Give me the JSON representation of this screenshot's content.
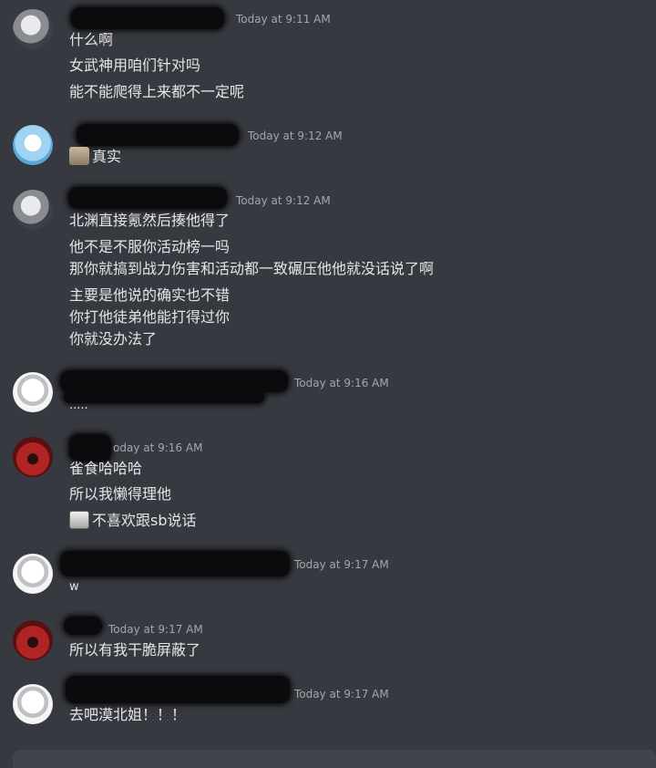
{
  "messages": [
    {
      "timestamp": "Today at 9:11 AM",
      "lines": [
        "什么啊",
        "女武神用咱们针对吗",
        "能不能爬得上来都不一定呢"
      ]
    },
    {
      "timestamp": "Today at 9:12 AM",
      "lines": [
        "真实"
      ]
    },
    {
      "timestamp": "Today at 9:12 AM",
      "lines": [
        "北渊直接氪然后揍他得了",
        "他不是不服你活动榜一吗",
        "那你就搞到战力伤害和活动都一致碾压他他就没话说了啊",
        "主要是他说的确实也不错",
        "你打他徒弟他能打得过你",
        "你就没办法了"
      ]
    },
    {
      "timestamp": "Today at 9:16 AM",
      "lines": [
        ".....",
        ""
      ]
    },
    {
      "timestamp": "oday at 9:16 AM",
      "lines": [
        "雀食哈哈哈",
        "所以我懒得理他",
        "不喜欢跟sb说话"
      ]
    },
    {
      "timestamp": "Today at 9:17 AM",
      "lines": [
        "w"
      ]
    },
    {
      "timestamp": "Today at 9:17 AM",
      "lines": [
        "所以有我干脆屏蔽了"
      ]
    },
    {
      "timestamp": "Today at 9:17 AM",
      "lines": [
        "去吧漠北姐！！！"
      ]
    }
  ],
  "icons": {
    "avatars": [
      "avatar-gray-character",
      "avatar-blue-girl",
      "avatar-white-cat",
      "avatar-red-sunset"
    ],
    "emojis": [
      "sticker-icon",
      "meme-sticker-icon"
    ]
  }
}
